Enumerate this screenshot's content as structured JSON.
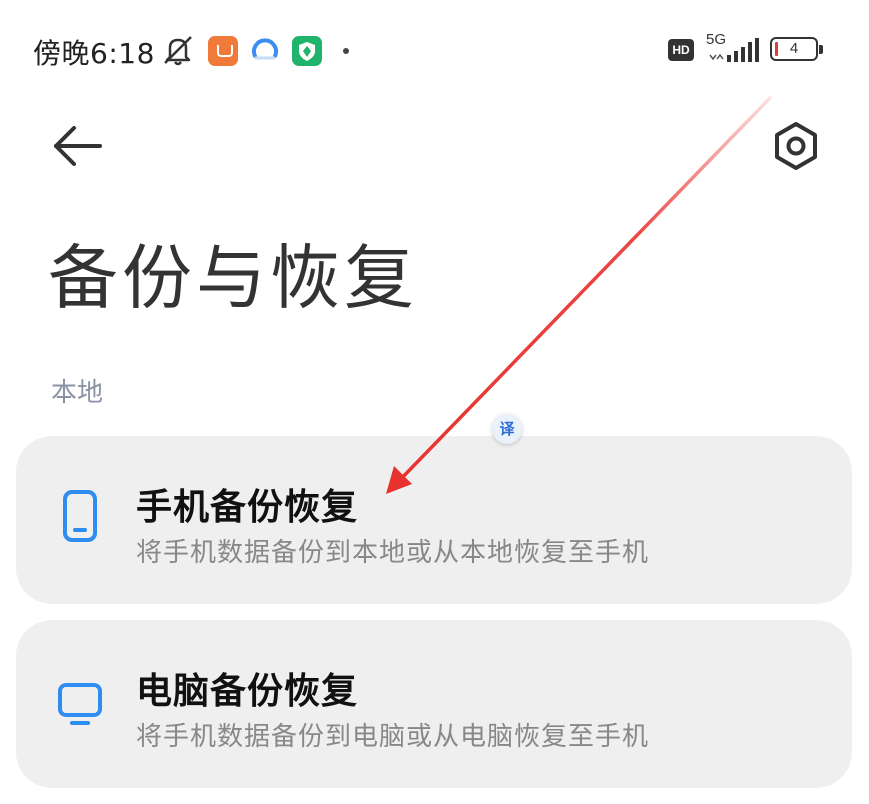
{
  "status_bar": {
    "time": "傍晚6:18",
    "hd_label": "HD",
    "network_type": "5G",
    "battery_level": "4",
    "icons": [
      "bell-muted-icon",
      "app-notification-orange-icon",
      "app-notification-arc-icon",
      "app-notification-shield-icon",
      "notification-dot",
      "hd-icon",
      "signal-strength-icon",
      "battery-icon"
    ]
  },
  "header": {
    "back_icon": "arrow-left-icon",
    "settings_icon": "hexagon-gear-icon",
    "title": "备份与恢复"
  },
  "section": {
    "label": "本地"
  },
  "cards": [
    {
      "icon": "phone-icon",
      "title": "手机备份恢复",
      "subtitle": "将手机数据备份到本地或从本地恢复至手机"
    },
    {
      "icon": "monitor-icon",
      "title": "电脑备份恢复",
      "subtitle": "将手机数据备份到电脑或从电脑恢复至手机"
    }
  ],
  "overlay": {
    "translate_label": "译",
    "arrow_icon": "red-annotation-arrow"
  },
  "colors": {
    "accent_blue": "#2f8cf0",
    "card_bg": "#efefef",
    "section_label": "#8a93a6",
    "annotation_red": "#e8322e",
    "battery_low": "#e23b3b"
  }
}
